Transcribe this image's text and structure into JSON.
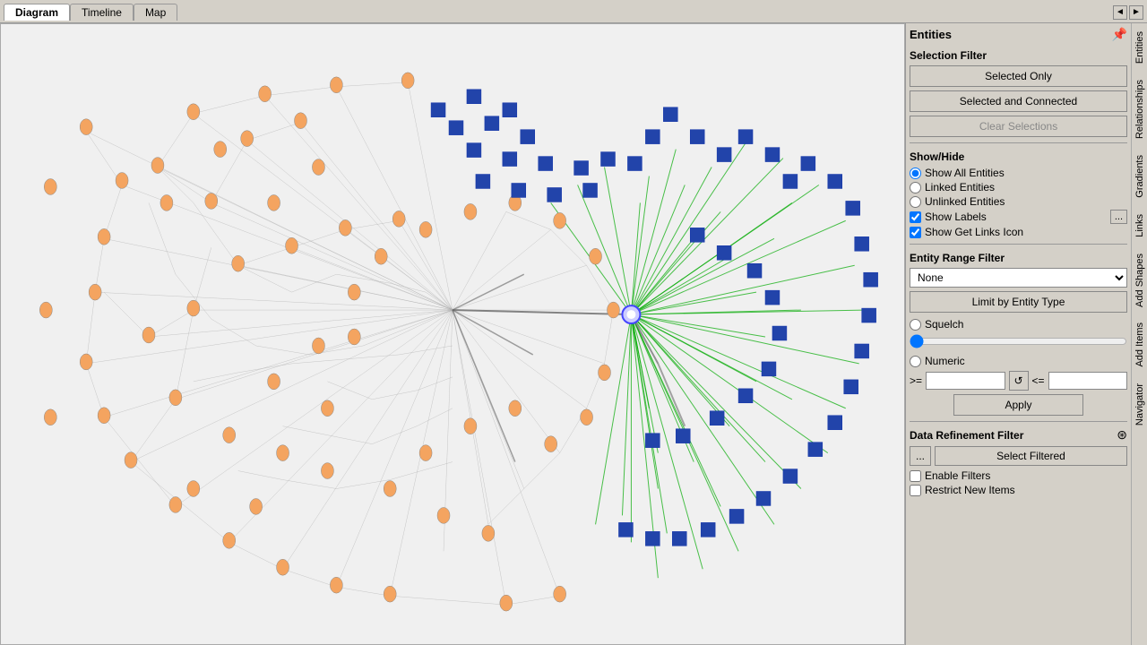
{
  "tabs": {
    "items": [
      {
        "label": "Diagram",
        "active": true
      },
      {
        "label": "Timeline",
        "active": false
      },
      {
        "label": "Map",
        "active": false
      }
    ]
  },
  "panel": {
    "title": "Entities",
    "pin_icon": "📌",
    "selection_filter": {
      "label": "Selection Filter",
      "selected_only_btn": "Selected Only",
      "selected_connected_btn": "Selected and Connected",
      "clear_selections_btn": "Clear Selections"
    },
    "show_hide": {
      "label": "Show/Hide",
      "options": [
        {
          "label": "Show All Entities",
          "value": "all",
          "checked": true
        },
        {
          "label": "Linked Entities",
          "value": "linked",
          "checked": false
        },
        {
          "label": "Unlinked Entities",
          "value": "unlinked",
          "checked": false
        }
      ],
      "show_labels": "Show Labels",
      "show_labels_checked": true,
      "show_get_links": "Show Get Links Icon",
      "show_get_links_checked": true,
      "ellipsis": "..."
    },
    "entity_range_filter": {
      "label": "Entity Range Filter",
      "dropdown_value": "None",
      "dropdown_options": [
        "None"
      ],
      "limit_btn": "Limit by Entity Type"
    },
    "squelch": {
      "label": "Squelch",
      "checked": false,
      "min": 0,
      "max": 100,
      "value": 0
    },
    "numeric": {
      "label": "Numeric",
      "checked": false,
      "gte_label": ">=",
      "lte_label": "<=",
      "gte_value": "",
      "lte_value": "",
      "refresh_icon": "↺",
      "apply_btn": "Apply"
    },
    "data_refinement": {
      "label": "Data Refinement Filter",
      "filter_icon": "⊛",
      "ellipsis": "...",
      "select_filtered_btn": "Select Filtered",
      "enable_filters_label": "Enable Filters",
      "enable_filters_checked": false,
      "restrict_new_items_label": "Restrict New Items",
      "restrict_new_items_checked": false
    },
    "vertical_tabs": [
      {
        "label": "Entities"
      },
      {
        "label": "Relationships"
      },
      {
        "label": "Gradients"
      },
      {
        "label": "Links"
      },
      {
        "label": "Add Shapes"
      },
      {
        "label": "Add Items"
      },
      {
        "label": "Navigator"
      }
    ]
  }
}
